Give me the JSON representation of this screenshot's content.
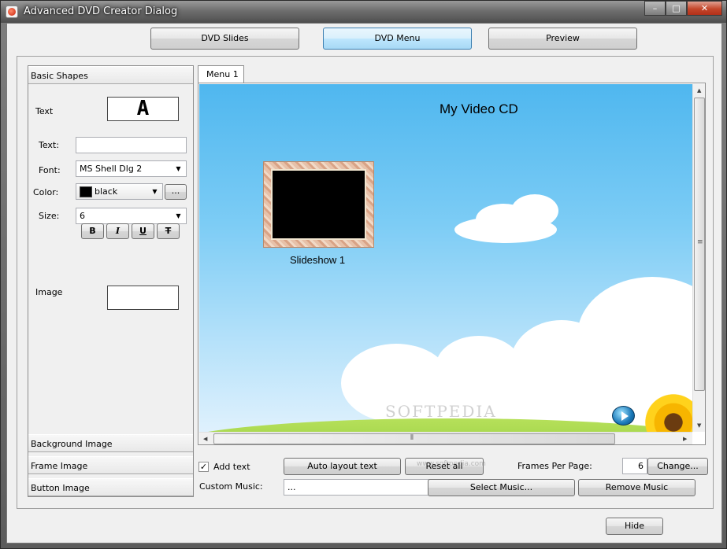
{
  "window": {
    "title": "Advanced DVD Creator Dialog",
    "minimize": "–",
    "maximize": "□",
    "close": "✕"
  },
  "top_tabs": {
    "slides": "DVD Slides",
    "menu": "DVD Menu",
    "preview": "Preview",
    "active": "DVD Menu"
  },
  "left_panel": {
    "basic_shapes": "Basic Shapes",
    "text_section": "Text",
    "text_preview_glyph": "A",
    "text_label": "Text:",
    "text_value": "",
    "font_label": "Font:",
    "font_value": "MS Shell Dlg 2",
    "color_label": "Color:",
    "color_value": "black",
    "color_swatch": "#000000",
    "color_more": "...",
    "size_label": "Size:",
    "size_value": "6",
    "bold": "B",
    "italic": "I",
    "underline": "U",
    "strike": "T",
    "image_section": "Image",
    "background_image": "Background Image",
    "frame_image": "Frame Image",
    "button_image": "Button Image"
  },
  "canvas": {
    "tab": "Menu 1",
    "menu_title": "My Video CD",
    "slide_label": "Slideshow 1"
  },
  "bottom": {
    "add_text_label": "Add text",
    "add_text_checked": true,
    "auto_layout": "Auto layout text",
    "reset_all": "Reset all",
    "frames_per_page_label": "Frames Per Page:",
    "frames_per_page_value": "6",
    "change": "Change...",
    "custom_music_label": "Custom Music:",
    "custom_music_value": "...",
    "select_music": "Select Music...",
    "remove_music": "Remove Music",
    "hide": "Hide"
  },
  "watermark": {
    "text": "SOFTPEDIA",
    "url": "www.softpedia.com"
  }
}
